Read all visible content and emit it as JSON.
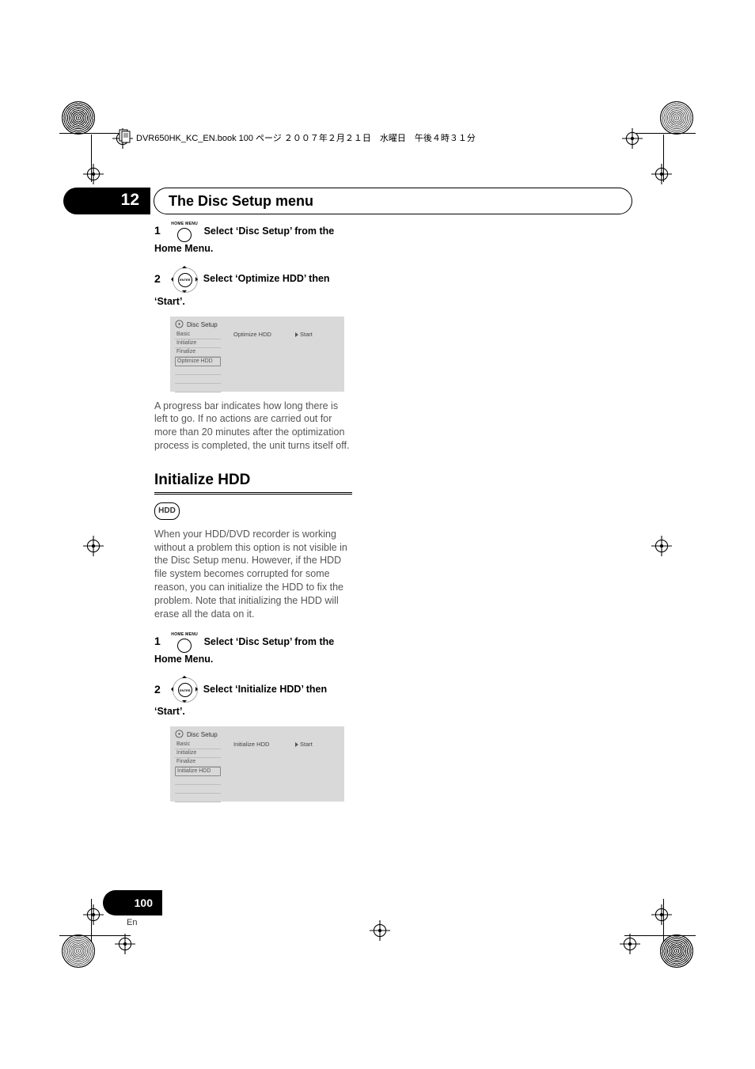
{
  "header_text": "DVR650HK_KC_EN.book  100 ページ  ２００７年２月２１日　水曜日　午後４時３１分",
  "chapter": {
    "number": "12",
    "title": "The Disc Setup menu"
  },
  "remote_labels": {
    "home_menu": "HOME MENU",
    "enter": "ENTER"
  },
  "steps_a": {
    "s1_num": "1",
    "s1_text_a": "Select ‘Disc Setup’ from the",
    "s1_text_b": "Home Menu.",
    "s2_num": "2",
    "s2_text_a": "Select ‘Optimize HDD’ then",
    "s2_text_b": "‘Start’."
  },
  "osd_a": {
    "title": "Disc Setup",
    "items": [
      "Basic",
      "Initialize",
      "Finalize",
      "Optimize HDD"
    ],
    "selected_index": 3,
    "mid": "Optimize HDD",
    "right": "Start"
  },
  "para_a": "A progress bar indicates how long there is left to go. If no actions are carried out for more than 20 minutes after the optimization process is completed, the unit turns itself off.",
  "section_b_heading": "Initialize HDD",
  "hdd_badge": "HDD",
  "para_b": "When your HDD/DVD recorder is working without a problem this option is not visible in the Disc Setup menu. However, if the HDD file system becomes corrupted for some reason, you can initialize the HDD to fix the problem. Note that initializing the HDD will erase all the data on it.",
  "steps_b": {
    "s1_num": "1",
    "s1_text_a": "Select ‘Disc Setup’ from the",
    "s1_text_b": "Home Menu.",
    "s2_num": "2",
    "s2_text_a": "Select ‘Initialize HDD’ then",
    "s2_text_b": "‘Start’."
  },
  "osd_b": {
    "title": "Disc Setup",
    "items": [
      "Basic",
      "Initialize",
      "Finalize",
      "Initialize HDD"
    ],
    "selected_index": 3,
    "mid": "Initialize HDD",
    "right": "Start"
  },
  "page_number": "100",
  "page_lang": "En"
}
